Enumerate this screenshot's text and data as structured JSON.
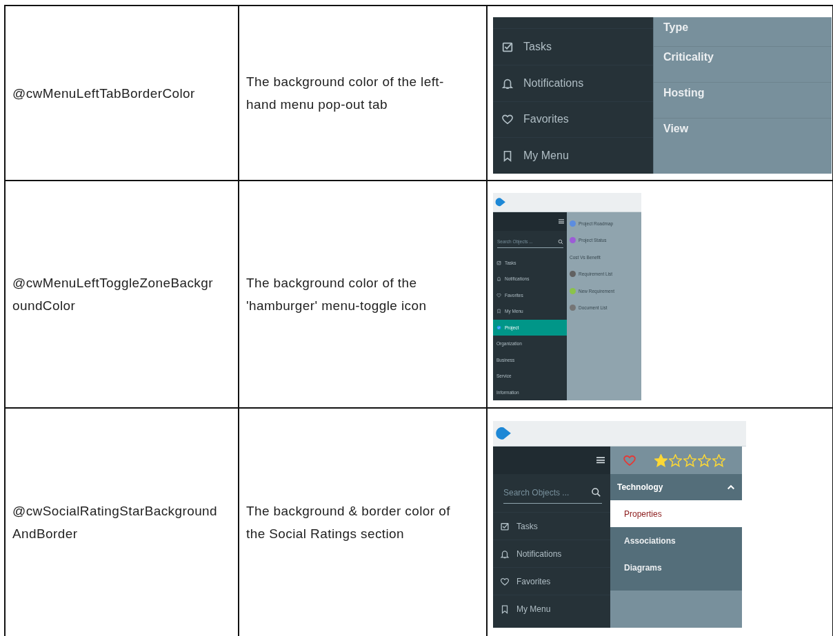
{
  "rows": [
    {
      "variable": "@cwMenuLeftTabBorderColor",
      "description": "The background color of the left-hand menu pop-out tab",
      "screenshot": {
        "kind": "popout",
        "menu_items": [
          {
            "label": "Tasks",
            "kind": "checklist"
          },
          {
            "label": "Notifications",
            "kind": "bell"
          },
          {
            "label": "Favorites",
            "kind": "heart"
          },
          {
            "label": "My Menu",
            "kind": "bookmark"
          }
        ],
        "submenu": [
          {
            "label": "Type"
          },
          {
            "label": "Criticality"
          },
          {
            "label": "Hosting"
          },
          {
            "label": "View"
          }
        ]
      }
    },
    {
      "variable": "@cwMenuLeftToggleZoneBackgroundColor",
      "description": "The background color of the 'hamburger' menu-toggle icon",
      "screenshot": {
        "kind": "toggle",
        "search_placeholder": "Search Objects ...",
        "menu_items": [
          {
            "label": "Tasks",
            "kind": "checklist",
            "selected": false
          },
          {
            "label": "Notifications",
            "kind": "bell",
            "selected": false
          },
          {
            "label": "Favorites",
            "kind": "heart",
            "selected": false
          },
          {
            "label": "My Menu",
            "kind": "bookmark",
            "selected": false
          },
          {
            "label": "Project",
            "kind": "check",
            "selected": true
          },
          {
            "label": "Organization",
            "kind": "none",
            "selected": false
          },
          {
            "label": "Business",
            "kind": "none",
            "selected": false
          },
          {
            "label": "Service",
            "kind": "none",
            "selected": false
          },
          {
            "label": "Information",
            "kind": "none",
            "selected": false
          }
        ],
        "submenu": [
          {
            "label": "Project Roadmap",
            "color": "#5c8de0"
          },
          {
            "label": "Project Status",
            "color": "#9c5cd6"
          },
          {
            "label": "Cost Vs Benefit"
          },
          {
            "label": "Requirement List",
            "color": "#616161"
          },
          {
            "label": "New Requirement",
            "color": "#8bc34a"
          },
          {
            "label": "Document List",
            "color": "#757575"
          }
        ]
      }
    },
    {
      "variable": "@cwSocialRatingStarBackgroundAndBorder",
      "description": "The background & border color of the Social Ratings section",
      "screenshot": {
        "kind": "rating",
        "search_placeholder": "Search Objects ...",
        "stars": 1,
        "menu_items": [
          {
            "label": "Tasks",
            "kind": "checklist"
          },
          {
            "label": "Notifications",
            "kind": "bell"
          },
          {
            "label": "Favorites",
            "kind": "heart"
          },
          {
            "label": "My Menu",
            "kind": "bookmark"
          }
        ],
        "section": {
          "title": "Technology",
          "expanded": true
        },
        "submenu": [
          {
            "label": "Properties",
            "selected": true
          },
          {
            "label": "Associations",
            "selected": false
          },
          {
            "label": "Diagrams",
            "selected": false
          }
        ]
      }
    }
  ]
}
